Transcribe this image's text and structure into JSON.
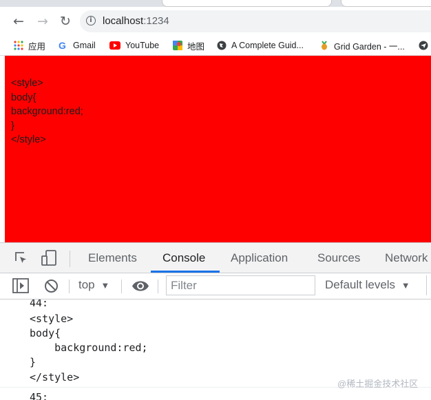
{
  "browser": {
    "url_host": "localhost",
    "url_port": ":1234"
  },
  "bookmarks": [
    {
      "label": "应用",
      "icon": "apps-grid-icon"
    },
    {
      "label": "Gmail",
      "icon": "google-icon"
    },
    {
      "label": "YouTube",
      "icon": "youtube-icon"
    },
    {
      "label": "地图",
      "icon": "maps-icon"
    },
    {
      "label": "A Complete Guid...",
      "icon": "globe-icon"
    },
    {
      "label": "Grid Garden - 一...",
      "icon": "carrot-icon"
    }
  ],
  "page": {
    "background": "#ff0000",
    "lines": [
      "<style>",
      "body{",
      "background:red;",
      "}",
      "</style>"
    ]
  },
  "devtools": {
    "tabs": [
      "Elements",
      "Console",
      "Application",
      "Sources",
      "Network"
    ],
    "active_tab": "Console",
    "context": "top",
    "filter_placeholder": "Filter",
    "levels": "Default levels",
    "accent": "#1a73e8"
  },
  "console": {
    "message1": {
      "label": "44:",
      "lines": [
        "<style>",
        "body{",
        "    background:red;",
        "}",
        "</style>"
      ]
    },
    "message2": {
      "label": "45:"
    }
  },
  "watermark": "@稀土掘金技术社区"
}
